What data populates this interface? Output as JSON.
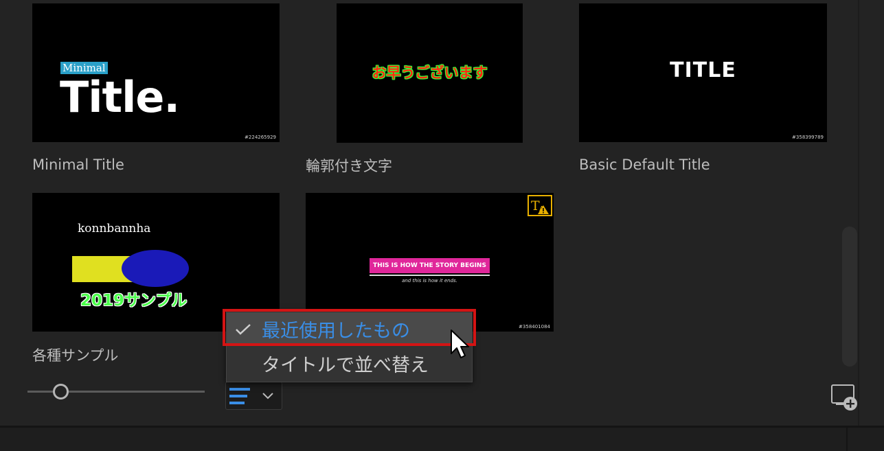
{
  "templates": [
    {
      "label": "Minimal Title",
      "tag": "Minimal",
      "headline": "Title.",
      "id": "#224265929"
    },
    {
      "label": "輪郭付き文字",
      "text": "お早うございます"
    },
    {
      "label": "Basic Default Title",
      "text": "TITLE",
      "id": "#358399789"
    },
    {
      "label": "各種サンプル",
      "line1": "konnbannha",
      "line2": "2019サンプル"
    },
    {
      "label": "",
      "headline": "THIS IS HOW THE STORY BEGINS",
      "subline": "and this is how it ends.",
      "id": "#358401084",
      "badge": "missing-font-warning-icon"
    }
  ],
  "sort_menu": {
    "items": [
      {
        "label": "最近使用したもの",
        "checked": true
      },
      {
        "label": "タイトルで並べ替え",
        "checked": false
      }
    ]
  },
  "thumbnail_size_slider": {
    "value_fraction": 0.19
  },
  "colors": {
    "accent": "#3a8ee6",
    "highlight_border": "#d41414",
    "panel": "#232323"
  },
  "icons": {
    "sort": "list-sort-icon",
    "chevron": "chevron-down-icon",
    "new": "new-item-icon",
    "check": "check-icon"
  }
}
